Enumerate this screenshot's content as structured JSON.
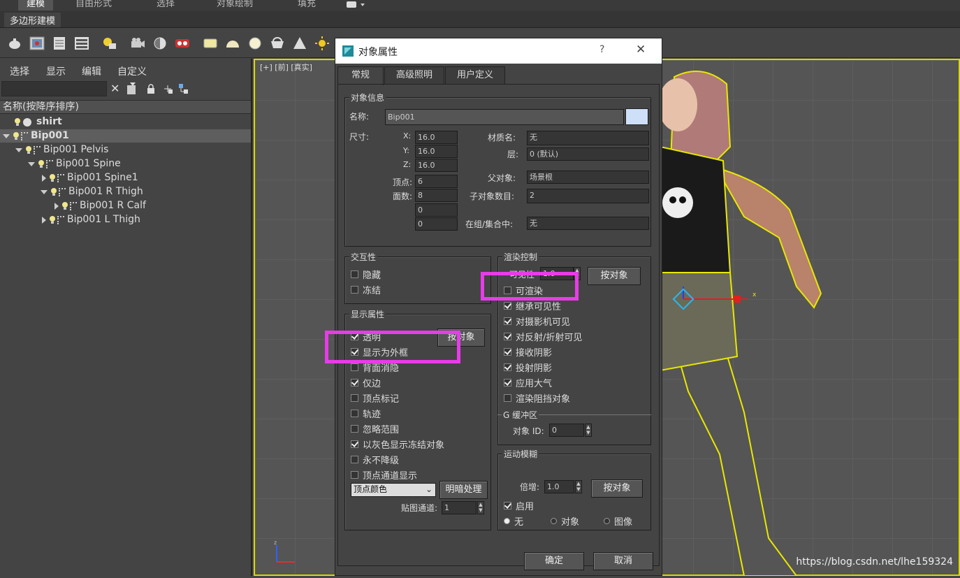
{
  "ribbon": {
    "tabs": [
      "建模",
      "自由形式",
      "选择",
      "对象绘制",
      "填充"
    ],
    "sub_label": "多边形建模"
  },
  "explorer": {
    "menus": [
      "选择",
      "显示",
      "编辑",
      "自定义"
    ],
    "column_header": "名称(按降序排序)",
    "items": [
      {
        "label": "shirt"
      },
      {
        "label": "Bip001"
      },
      {
        "label": "Bip001 Pelvis"
      },
      {
        "label": "Bip001 Spine"
      },
      {
        "label": "Bip001 Spine1"
      },
      {
        "label": "Bip001 R Thigh"
      },
      {
        "label": "Bip001 R Calf"
      },
      {
        "label": "Bip001 L Thigh"
      }
    ]
  },
  "viewport": {
    "label": "[+] [前] [真实]",
    "axis_x": "x",
    "axis_z": "z"
  },
  "dialog": {
    "title": "对象属性",
    "help": "?",
    "close": "✕",
    "tabs": [
      "常规",
      "高级照明",
      "用户定义"
    ],
    "object_info": {
      "title": "对象信息",
      "name_label": "名称:",
      "name_value": "Bip001",
      "dims_label": "尺寸:",
      "x_label": "X:",
      "x_value": "16.0",
      "y_label": "Y:",
      "y_value": "16.0",
      "z_label": "Z:",
      "z_value": "16.0",
      "verts_label": "顶点:",
      "verts_value": "6",
      "faces_label": "面数:",
      "faces_value": "8",
      "extra1_value": "0",
      "extra2_value": "0",
      "material_label": "材质名:",
      "material_value": "无",
      "layer_label": "层:",
      "layer_value": "0 (默认)",
      "parent_label": "父对象:",
      "parent_value": "场景根",
      "children_label": "子对象数目:",
      "children_value": "2",
      "group_label": "在组/集合中:",
      "group_value": "无"
    },
    "interactivity": {
      "title": "交互性",
      "hide": "隐藏",
      "freeze": "冻结"
    },
    "display": {
      "title": "显示属性",
      "transparent": "透明",
      "display_as_box": "显示为外框",
      "backface_cull": "背面消隐",
      "edges_only": "仅边",
      "vertex_ticks": "顶点标记",
      "trajectory": "轨迹",
      "ignore_extents": "忽略范围",
      "gray_frozen": "以灰色显示冻结对象",
      "never_degrade": "永不降级",
      "vertex_channel": "顶点通道显示",
      "by_object": "按对象",
      "vertex_color_select": "顶点颜色",
      "shaded_button": "明暗处理",
      "map_channel_label": "贴图通道:",
      "map_channel_value": "1"
    },
    "render": {
      "title": "渲染控制",
      "visibility_label": "可见性",
      "visibility_value": "1.0",
      "by_object": "按对象",
      "renderable": "可渲染",
      "inherit_visibility": "继承可见性",
      "visible_camera": "对摄影机可见",
      "visible_reflect": "对反射/折射可见",
      "receive_shadows": "接收阴影",
      "cast_shadows": "投射阴影",
      "apply_atmos": "应用大气",
      "render_occluded": "渲染阻挡对象"
    },
    "gbuffer": {
      "title": "G 缓冲区",
      "obj_id_label": "对象 ID:",
      "obj_id_value": "0"
    },
    "motion_blur": {
      "title": "运动模糊",
      "multiplier_label": "倍增:",
      "multiplier_value": "1.0",
      "by_object": "按对象",
      "enabled": "启用",
      "none": "无",
      "object": "对象",
      "image": "图像"
    },
    "ok": "确定",
    "cancel": "取消"
  },
  "watermark": "https://blog.csdn.net/lhe159324",
  "colors": {
    "highlight": "#e83ce8",
    "selection": "#d8d800"
  }
}
